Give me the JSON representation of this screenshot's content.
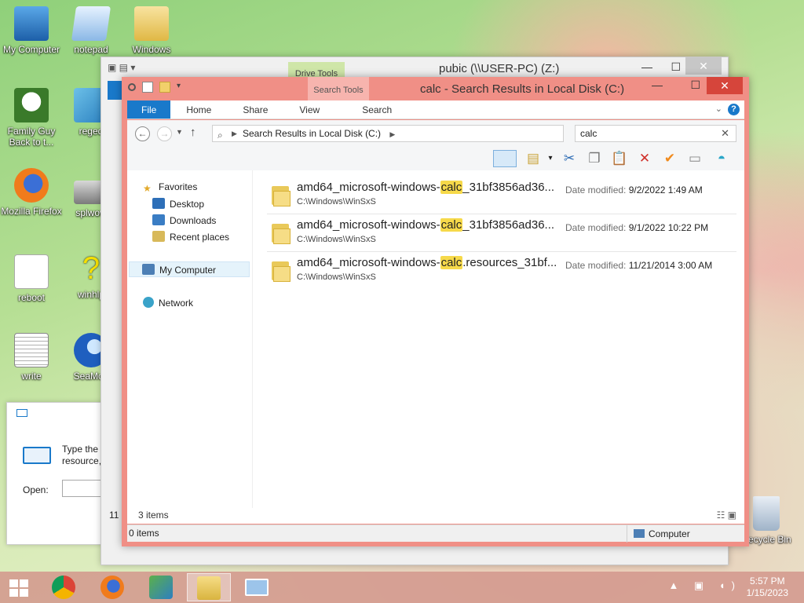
{
  "desktop": {
    "icons": [
      {
        "label": "My Computer"
      },
      {
        "label": "notepad"
      },
      {
        "label": "Windows"
      },
      {
        "label": "Family Guy Back to t..."
      },
      {
        "label": "reged"
      },
      {
        "label": "Mozilla Firefox"
      },
      {
        "label": "splwow"
      },
      {
        "label": "reboot"
      },
      {
        "label": "winhlp"
      },
      {
        "label": "write"
      },
      {
        "label": "SeaMon"
      },
      {
        "label": "Recycle Bin"
      }
    ]
  },
  "back_window": {
    "title": "pubic (\\\\USER-PC) (Z:)",
    "context_tab": "Drive Tools",
    "status_fragment": "11"
  },
  "run_dialog": {
    "text": "Type the resource,",
    "open_label": "Open:"
  },
  "explorer": {
    "title": "calc - Search Results in Local Disk (C:)",
    "context_tab": "Search Tools",
    "tabs": [
      "File",
      "Home",
      "Share",
      "View",
      "Search"
    ],
    "address": "Search Results in Local Disk (C:)",
    "search_value": "calc",
    "nav": {
      "favorites": "Favorites",
      "desktop": "Desktop",
      "downloads": "Downloads",
      "recent": "Recent places",
      "computer": "My Computer",
      "network": "Network"
    },
    "date_label": "Date modified:",
    "results": [
      {
        "pre": "amd64_microsoft-windows-",
        "hit": "calc",
        "post": "_31bf3856ad36...",
        "path": "C:\\Windows\\WinSxS",
        "date": "9/2/2022 1:49 AM"
      },
      {
        "pre": "amd64_microsoft-windows-",
        "hit": "calc",
        "post": "_31bf3856ad36...",
        "path": "C:\\Windows\\WinSxS",
        "date": "9/1/2022 10:22 PM"
      },
      {
        "pre": "amd64_microsoft-windows-",
        "hit": "calc",
        "post": ".resources_31bf...",
        "path": "C:\\Windows\\WinSxS",
        "date": "11/21/2014 3:00 AM"
      }
    ],
    "item_count": "3 items",
    "selected_count": "0 items",
    "zone": "Computer"
  },
  "taskbar": {
    "time": "5:57 PM",
    "date": "1/15/2023"
  },
  "colors": {
    "accent": "#1979ca",
    "window_frame": "#f08f86",
    "close_button": "#d6453b",
    "highlight": "#f6d94a"
  }
}
